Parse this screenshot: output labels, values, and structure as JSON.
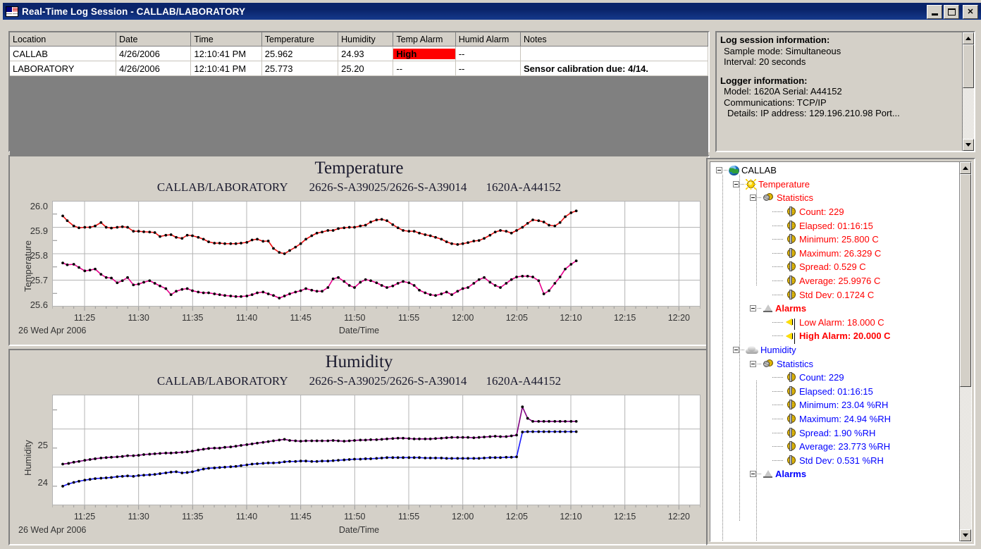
{
  "window": {
    "title": "Real-Time Log Session - CALLAB/LABORATORY",
    "minimize_label": "_",
    "maximize_label": "□",
    "close_label": "✕"
  },
  "grid": {
    "columns": [
      "Location",
      "Date",
      "Time",
      "Temperature",
      "Humidity",
      "Temp Alarm",
      "Humid Alarm",
      "Notes"
    ],
    "rows": [
      {
        "location": "CALLAB",
        "date": "4/26/2006",
        "time": "12:10:41 PM",
        "temperature": "25.962",
        "humidity": "24.93",
        "temp_alarm": "High",
        "humid_alarm": "--",
        "notes": ""
      },
      {
        "location": "LABORATORY",
        "date": "4/26/2006",
        "time": "12:10:41 PM",
        "temperature": "25.773",
        "humidity": "25.20",
        "temp_alarm": "--",
        "humid_alarm": "--",
        "notes": "Sensor calibration due: 4/14."
      }
    ]
  },
  "info": {
    "session_header": "Log session information:",
    "sample_mode": "Sample mode: Simultaneous",
    "interval": "Interval: 20 seconds",
    "logger_header": "Logger information:",
    "model": "Model: 1620A  Serial: A44152",
    "communications": "Communications: TCP/IP",
    "details": "Details:  IP address: 129.196.210.98 Port..."
  },
  "tree": {
    "root": "CALLAB",
    "temperature": {
      "label": "Temperature",
      "statistics_label": "Statistics",
      "stats": [
        "Count: 229",
        "Elapsed: 01:16:15",
        "Minimum: 25.800 C",
        "Maximum: 26.329 C",
        "Spread: 0.529 C",
        "Average: 25.9976 C",
        "Std Dev: 0.1724 C"
      ],
      "alarms_label": "Alarms",
      "low_alarm": "Low Alarm: 18.000 C",
      "high_alarm": "High Alarm: 20.000 C"
    },
    "humidity": {
      "label": "Humidity",
      "statistics_label": "Statistics",
      "stats": [
        "Count: 229",
        "Elapsed: 01:16:15",
        "Minimum: 23.04 %RH",
        "Maximum: 24.94 %RH",
        "Spread: 1.90 %RH",
        "Average: 23.773 %RH",
        "Std Dev: 0.531 %RH"
      ]
    }
  },
  "colors": {
    "temp_series_1": "#ee1111",
    "temp_series_2": "#e6008c",
    "hum_series_1": "#800080",
    "hum_series_2": "#1a1aff",
    "alarm_bg": "#ff0000",
    "titlebar": "#0a246a"
  },
  "chart_data": [
    {
      "type": "line",
      "title": "Temperature",
      "subtitle_left": "CALLAB/LABORATORY",
      "subtitle_mid": "2626-S-A39025/2626-S-A39014",
      "subtitle_right": "1620A-A44152",
      "xlabel": "Date/Time",
      "ylabel": "Temperature",
      "datestamp": "26 Wed Apr 2006",
      "xticks": [
        "11:25",
        "11:30",
        "11:35",
        "11:40",
        "11:45",
        "11:50",
        "11:55",
        "12:00",
        "12:05",
        "12:10",
        "12:15",
        "12:20"
      ],
      "yticks": [
        "26.0",
        "25.9",
        "25.8",
        "25.7",
        "25.6"
      ],
      "ylim": [
        25.6,
        26.0
      ],
      "xlim": [
        "11:22",
        "12:22"
      ],
      "grid": true,
      "series": [
        {
          "name": "CALLAB",
          "color": "#ee1111",
          "x": [
            11.383,
            11.39,
            11.4,
            11.408,
            11.417,
            11.425,
            11.433,
            11.442,
            11.45,
            11.458,
            11.467,
            11.475,
            11.483,
            11.492,
            11.5,
            11.508,
            11.517,
            11.525,
            11.533,
            11.542,
            11.55,
            11.558,
            11.567,
            11.575,
            11.583,
            11.592,
            11.6,
            11.608,
            11.617,
            11.625,
            11.633,
            11.642,
            11.65,
            11.658,
            11.667,
            11.675,
            11.683,
            11.692,
            11.7,
            11.708,
            11.717,
            11.725,
            11.733,
            11.742,
            11.75,
            11.758,
            11.767,
            11.775,
            11.783,
            11.792,
            11.8,
            11.808,
            11.817,
            11.825,
            11.833,
            11.842,
            11.85,
            11.858,
            11.867,
            11.875,
            11.883,
            11.892,
            11.9,
            11.908,
            11.917,
            11.925,
            11.933,
            11.942,
            11.95,
            11.958,
            11.967,
            11.975,
            11.983,
            11.992,
            12.0,
            12.008,
            12.017,
            12.025,
            12.033,
            12.042,
            12.05,
            12.058,
            12.067,
            12.075,
            12.083,
            12.092,
            12.1,
            12.108,
            12.117,
            12.125,
            12.133,
            12.142,
            12.15,
            12.158,
            12.167,
            12.175
          ],
          "y": [
            25.943,
            25.925,
            25.905,
            25.898,
            25.9,
            25.9,
            25.905,
            25.918,
            25.9,
            25.897,
            25.9,
            25.902,
            25.9,
            25.885,
            25.885,
            25.883,
            25.882,
            25.88,
            25.865,
            25.87,
            25.872,
            25.862,
            25.858,
            25.87,
            25.868,
            25.862,
            25.855,
            25.845,
            25.84,
            25.84,
            25.838,
            25.838,
            25.838,
            25.84,
            25.843,
            25.852,
            25.855,
            25.847,
            25.848,
            25.82,
            25.805,
            25.8,
            25.812,
            25.825,
            25.838,
            25.855,
            25.868,
            25.878,
            25.882,
            25.888,
            25.888,
            25.895,
            25.898,
            25.9,
            25.9,
            25.905,
            25.908,
            25.92,
            25.928,
            25.93,
            25.925,
            25.91,
            25.898,
            25.888,
            25.885,
            25.885,
            25.878,
            25.872,
            25.868,
            25.862,
            25.855,
            25.845,
            25.838,
            25.835,
            25.838,
            25.842,
            25.848,
            25.85,
            25.858,
            25.87,
            25.882,
            25.888,
            25.885,
            25.878,
            25.888,
            25.9,
            25.915,
            25.928,
            25.925,
            25.92,
            25.908,
            25.905,
            25.918,
            25.94,
            25.955,
            25.962
          ]
        },
        {
          "name": "LABORATORY",
          "color": "#e6008c",
          "x": [
            11.383,
            11.39,
            11.4,
            11.408,
            11.417,
            11.425,
            11.433,
            11.442,
            11.45,
            11.458,
            11.467,
            11.475,
            11.483,
            11.492,
            11.5,
            11.508,
            11.517,
            11.525,
            11.533,
            11.542,
            11.55,
            11.558,
            11.567,
            11.575,
            11.583,
            11.592,
            11.6,
            11.608,
            11.617,
            11.625,
            11.633,
            11.642,
            11.65,
            11.658,
            11.667,
            11.675,
            11.683,
            11.692,
            11.7,
            11.708,
            11.717,
            11.725,
            11.733,
            11.742,
            11.75,
            11.758,
            11.767,
            11.775,
            11.783,
            11.792,
            11.8,
            11.808,
            11.817,
            11.825,
            11.833,
            11.842,
            11.85,
            11.858,
            11.867,
            11.875,
            11.883,
            11.892,
            11.9,
            11.908,
            11.917,
            11.925,
            11.933,
            11.942,
            11.95,
            11.958,
            11.967,
            11.975,
            11.983,
            11.992,
            12.0,
            12.008,
            12.017,
            12.025,
            12.033,
            12.042,
            12.05,
            12.058,
            12.067,
            12.075,
            12.083,
            12.092,
            12.1,
            12.108,
            12.117,
            12.125,
            12.133,
            12.142,
            12.15,
            12.158,
            12.167,
            12.175
          ],
          "y": [
            25.765,
            25.758,
            25.76,
            25.748,
            25.735,
            25.738,
            25.742,
            25.722,
            25.71,
            25.708,
            25.69,
            25.698,
            25.71,
            25.682,
            25.685,
            25.692,
            25.698,
            25.688,
            25.678,
            25.668,
            25.645,
            25.658,
            25.665,
            25.668,
            25.66,
            25.655,
            25.652,
            25.652,
            25.648,
            25.645,
            25.642,
            25.64,
            25.638,
            25.638,
            25.64,
            25.645,
            25.652,
            25.655,
            25.648,
            25.642,
            25.632,
            25.64,
            25.648,
            25.655,
            25.66,
            25.668,
            25.662,
            25.658,
            25.658,
            25.672,
            25.705,
            25.71,
            25.695,
            25.68,
            25.672,
            25.692,
            25.702,
            25.698,
            25.69,
            25.68,
            25.672,
            25.678,
            25.688,
            25.695,
            25.69,
            25.68,
            25.662,
            25.652,
            25.645,
            25.642,
            25.648,
            25.655,
            25.645,
            25.658,
            25.668,
            25.672,
            25.688,
            25.702,
            25.71,
            25.692,
            25.68,
            25.672,
            25.688,
            25.702,
            25.712,
            25.715,
            25.715,
            25.712,
            25.698,
            25.648,
            25.66,
            25.688,
            25.712,
            25.742,
            25.76,
            25.773
          ]
        }
      ]
    },
    {
      "type": "line",
      "title": "Humidity",
      "subtitle_left": "CALLAB/LABORATORY",
      "subtitle_mid": "2626-S-A39025/2626-S-A39014",
      "subtitle_right": "1620A-A44152",
      "xlabel": "Date/Time",
      "ylabel": "Humidity",
      "datestamp": "26 Wed Apr 2006",
      "xticks": [
        "11:25",
        "11:30",
        "11:35",
        "11:40",
        "11:45",
        "11:50",
        "11:55",
        "12:00",
        "12:05",
        "12:10",
        "12:15",
        "12:20"
      ],
      "yticks": [
        "25",
        "24"
      ],
      "ylim": [
        23.0,
        25.9
      ],
      "xlim": [
        "11:22",
        "12:22"
      ],
      "grid": true,
      "series": [
        {
          "name": "LABORATORY",
          "color": "#800080",
          "x": [
            11.383,
            11.392,
            11.4,
            11.408,
            11.417,
            11.425,
            11.433,
            11.442,
            11.45,
            11.458,
            11.467,
            11.475,
            11.483,
            11.492,
            11.5,
            11.508,
            11.517,
            11.525,
            11.533,
            11.542,
            11.55,
            11.558,
            11.567,
            11.575,
            11.583,
            11.592,
            11.6,
            11.608,
            11.617,
            11.625,
            11.633,
            11.642,
            11.65,
            11.658,
            11.667,
            11.675,
            11.683,
            11.692,
            11.7,
            11.708,
            11.717,
            11.725,
            11.733,
            11.742,
            11.75,
            11.758,
            11.767,
            11.775,
            11.783,
            11.792,
            11.8,
            11.808,
            11.817,
            11.825,
            11.833,
            11.842,
            11.85,
            11.858,
            11.867,
            11.875,
            11.883,
            11.892,
            11.9,
            11.908,
            11.917,
            11.925,
            11.933,
            11.942,
            11.95,
            11.958,
            11.967,
            11.975,
            11.983,
            11.992,
            12.0,
            12.008,
            12.017,
            12.025,
            12.033,
            12.042,
            12.05,
            12.058,
            12.067,
            12.075,
            12.083,
            12.092,
            12.1,
            12.108,
            12.117,
            12.125,
            12.133,
            12.142,
            12.15,
            12.158,
            12.167,
            12.175
          ],
          "y": [
            24.08,
            24.1,
            24.13,
            24.15,
            24.18,
            24.2,
            24.22,
            24.24,
            24.25,
            24.26,
            24.27,
            24.28,
            24.3,
            24.3,
            24.31,
            24.33,
            24.34,
            24.35,
            24.36,
            24.37,
            24.37,
            24.38,
            24.39,
            24.4,
            24.42,
            24.45,
            24.47,
            24.49,
            24.5,
            24.5,
            24.52,
            24.53,
            24.55,
            24.57,
            24.59,
            24.61,
            24.63,
            24.65,
            24.67,
            24.69,
            24.71,
            24.73,
            24.7,
            24.69,
            24.68,
            24.69,
            24.69,
            24.69,
            24.69,
            24.69,
            24.7,
            24.69,
            24.68,
            24.69,
            24.7,
            24.71,
            24.71,
            24.72,
            24.72,
            24.73,
            24.74,
            24.75,
            24.76,
            24.76,
            24.75,
            24.74,
            24.74,
            24.74,
            24.74,
            24.75,
            24.76,
            24.77,
            24.78,
            24.78,
            24.78,
            24.78,
            24.77,
            24.78,
            24.79,
            24.8,
            24.81,
            24.8,
            24.8,
            24.82,
            24.84,
            25.58,
            25.28,
            25.2,
            25.2,
            25.2,
            25.2,
            25.2,
            25.2,
            25.2,
            25.2,
            25.2
          ]
        },
        {
          "name": "CALLAB",
          "color": "#1a1aff",
          "x": [
            11.383,
            11.392,
            11.4,
            11.408,
            11.417,
            11.425,
            11.433,
            11.442,
            11.45,
            11.458,
            11.467,
            11.475,
            11.483,
            11.492,
            11.5,
            11.508,
            11.517,
            11.525,
            11.533,
            11.542,
            11.55,
            11.558,
            11.567,
            11.575,
            11.583,
            11.592,
            11.6,
            11.608,
            11.617,
            11.625,
            11.633,
            11.642,
            11.65,
            11.658,
            11.667,
            11.675,
            11.683,
            11.692,
            11.7,
            11.708,
            11.717,
            11.725,
            11.733,
            11.742,
            11.75,
            11.758,
            11.767,
            11.775,
            11.783,
            11.792,
            11.8,
            11.808,
            11.817,
            11.825,
            11.833,
            11.842,
            11.85,
            11.858,
            11.867,
            11.875,
            11.883,
            11.892,
            11.9,
            11.908,
            11.917,
            11.925,
            11.933,
            11.942,
            11.95,
            11.958,
            11.967,
            11.975,
            11.983,
            11.992,
            12.0,
            12.008,
            12.017,
            12.025,
            12.033,
            12.042,
            12.05,
            12.058,
            12.067,
            12.075,
            12.083,
            12.092,
            12.1,
            12.108,
            12.117,
            12.125,
            12.133,
            12.142,
            12.15,
            12.158,
            12.167,
            12.175
          ],
          "y": [
            23.5,
            23.56,
            23.6,
            23.63,
            23.66,
            23.68,
            23.7,
            23.71,
            23.72,
            23.73,
            23.75,
            23.76,
            23.77,
            23.76,
            23.78,
            23.79,
            23.8,
            23.81,
            23.83,
            23.85,
            23.87,
            23.88,
            23.85,
            23.86,
            23.88,
            23.92,
            23.95,
            23.97,
            23.98,
            23.99,
            24.0,
            24.01,
            24.02,
            24.04,
            24.06,
            24.08,
            24.09,
            24.1,
            24.11,
            24.11,
            24.12,
            24.14,
            24.15,
            24.15,
            24.16,
            24.16,
            24.15,
            24.15,
            24.16,
            24.16,
            24.17,
            24.18,
            24.19,
            24.2,
            24.21,
            24.21,
            24.22,
            24.22,
            24.23,
            24.24,
            24.25,
            24.25,
            24.25,
            24.25,
            24.25,
            24.25,
            24.25,
            24.24,
            24.24,
            24.24,
            24.24,
            24.23,
            24.23,
            24.23,
            24.23,
            24.23,
            24.23,
            24.23,
            24.24,
            24.25,
            24.25,
            24.25,
            24.26,
            24.26,
            24.27,
            24.92,
            24.93,
            24.93,
            24.93,
            24.93,
            24.93,
            24.93,
            24.93,
            24.93,
            24.93,
            24.93
          ]
        }
      ]
    }
  ]
}
